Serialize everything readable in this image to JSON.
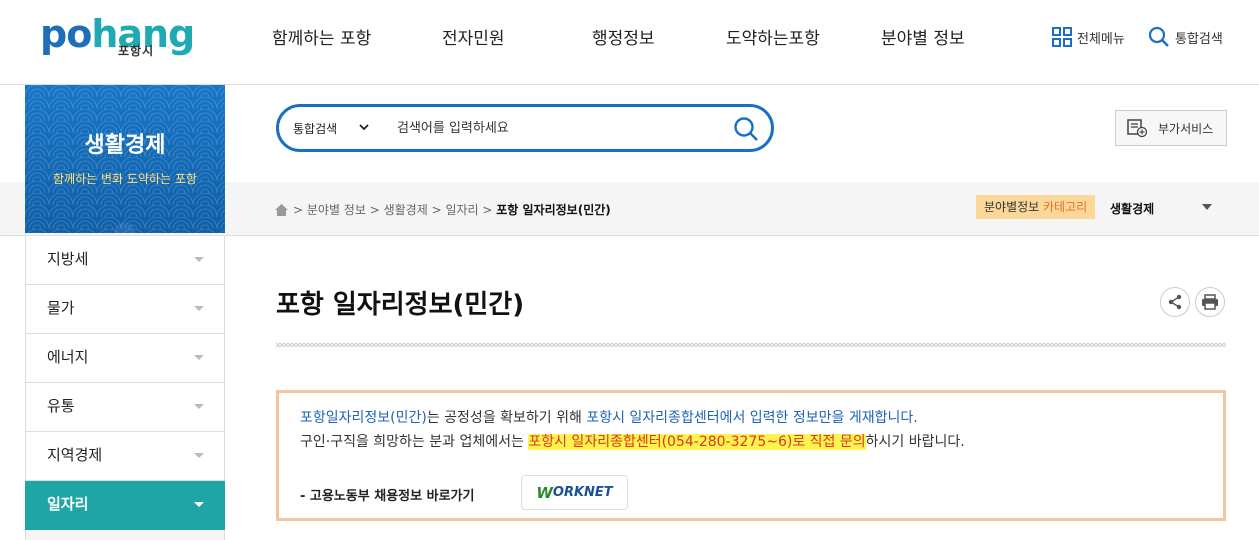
{
  "header": {
    "logo": {
      "word_a": "po",
      "word_b": "hang",
      "sub": "포항시"
    },
    "gnb": [
      "함께하는 포항",
      "전자민원",
      "행정정보",
      "도약하는포항",
      "분야별 정보"
    ],
    "util": {
      "all_menu": "전체메뉴",
      "search": "통합검색"
    }
  },
  "side": {
    "title": "생활경제",
    "slogan": "함께하는 변화 도약하는 포항"
  },
  "search": {
    "select": "통합검색",
    "placeholder": "검색어를 입력하세요"
  },
  "extra_service": "부가서비스",
  "breadcrumb": {
    "items": [
      "분야별 정보",
      "생활경제",
      "일자리"
    ],
    "current": "포항 일자리정보(민간)"
  },
  "category": {
    "label_a": "분야별정보 ",
    "label_b": "카테고리",
    "value": "생활경제"
  },
  "lnb": [
    "지방세",
    "물가",
    "에너지",
    "유통",
    "지역경제",
    "일자리"
  ],
  "lnb_active_index": 5,
  "page_title": "포항 일자리정보(민간)",
  "notice": {
    "l1_a": "포항일자리정보(민간)",
    "l1_b": "는 공정성을 확보하기 위해 ",
    "l1_c": "포항시 일자리종합센터에서 입력한 정보만을 게재합니다.",
    "l2_a": "구인·구직을 희망하는 분과 업체에서는 ",
    "l2_b": "포항시 일자리종합센터(054-280-3275~6)로 직접 문의",
    "l2_c": "하시기 바랍니다.",
    "l3": "- 고용노동부 채용정보 바로가기",
    "worknet_w": "W",
    "worknet_rest": "ORKNET"
  },
  "colors": {
    "primary": "#1a6fc4",
    "teal": "#1fa5a3",
    "highlight": "#fff34f",
    "alert": "#d9381e"
  }
}
